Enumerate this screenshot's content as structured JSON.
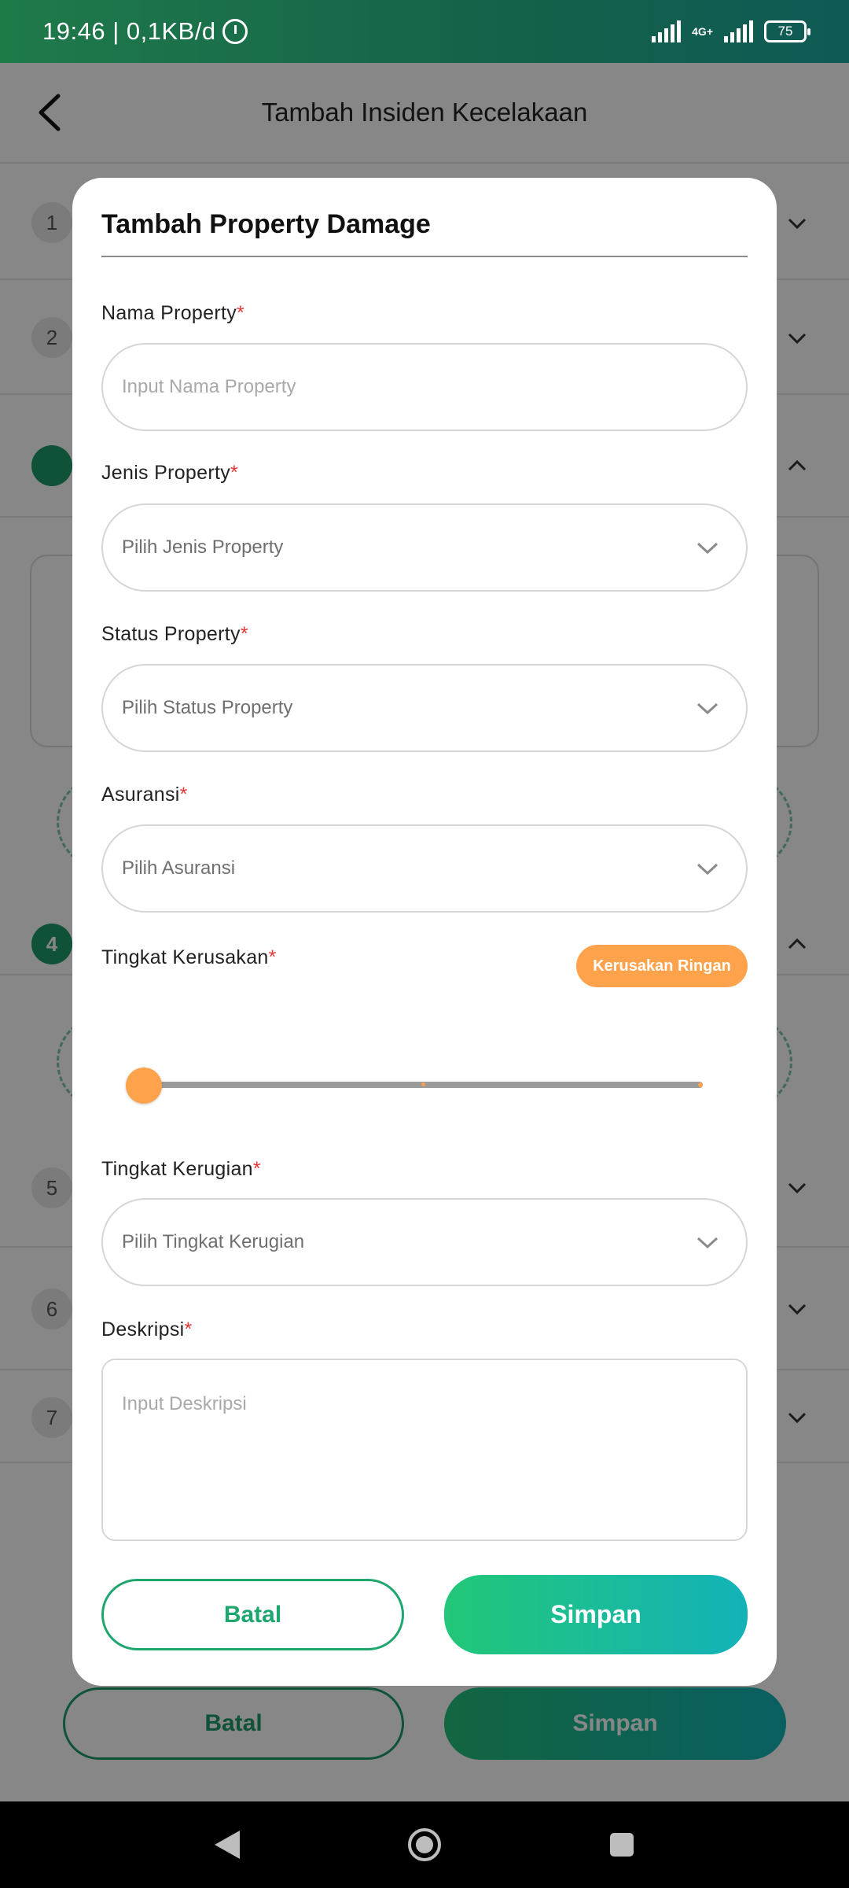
{
  "status_bar": {
    "time": "19:46 | 0,1KB/d",
    "network": "4G+",
    "battery": "75"
  },
  "header": {
    "title": "Tambah Insiden Kecelakaan"
  },
  "background": {
    "steps": [
      "1",
      "2",
      "4",
      "5",
      "6",
      "7"
    ],
    "buttons": {
      "cancel": "Batal",
      "save": "Simpan"
    }
  },
  "modal": {
    "title": "Tambah Property Damage",
    "required_mark": "*",
    "fields": {
      "nama_property": {
        "label": "Nama Property",
        "placeholder": "Input Nama Property"
      },
      "jenis_property": {
        "label": "Jenis Property",
        "placeholder": "Pilih Jenis Property"
      },
      "status_property": {
        "label": "Status Property",
        "placeholder": "Pilih Status Property"
      },
      "asuransi": {
        "label": "Asuransi",
        "placeholder": "Pilih Asuransi"
      },
      "tingkat_kerusakan": {
        "label": "Tingkat Kerusakan",
        "badge": "Kerusakan Ringan",
        "slider_value": 0
      },
      "tingkat_kerugian": {
        "label": "Tingkat Kerugian",
        "placeholder": "Pilih Tingkat Kerugian"
      },
      "deskripsi": {
        "label": "Deskripsi",
        "placeholder": "Input Deskripsi"
      }
    },
    "buttons": {
      "cancel": "Batal",
      "save": "Simpan"
    }
  },
  "colors": {
    "accent_green": "#1ea66f",
    "slider_orange": "#ffa24c",
    "required_red": "#e53935"
  }
}
